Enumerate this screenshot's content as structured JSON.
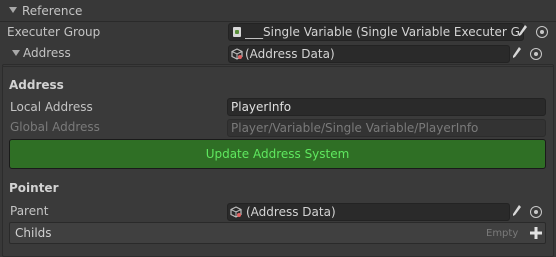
{
  "reference": {
    "header_label": "Reference"
  },
  "executer_group": {
    "label": "Executer Group",
    "value": "___Single Variable (Single Variable Executer Group)",
    "icon": "script-icon"
  },
  "address": {
    "label": "Address",
    "value": "(Address Data)",
    "icon": "scriptable-object-icon"
  },
  "address_section": {
    "title": "Address",
    "local_address_label": "Local Address",
    "local_address_value": "PlayerInfo",
    "global_address_label": "Global Address",
    "global_address_value": "Player/Variable/Single Variable/PlayerInfo",
    "update_button_label": "Update Address System"
  },
  "pointer_section": {
    "title": "Pointer",
    "parent_label": "Parent",
    "parent_value": "(Address Data)",
    "childs_label": "Childs",
    "childs_empty_label": "Empty"
  },
  "colors": {
    "background": "#383838",
    "button_green": "#2f6f25",
    "button_text_green": "#5fe85f"
  }
}
